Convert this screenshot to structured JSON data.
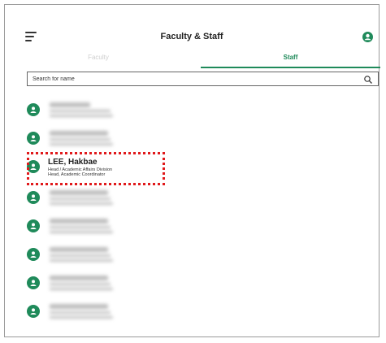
{
  "header": {
    "title": "Faculty & Staff"
  },
  "tabs": [
    {
      "label": "Faculty",
      "active": false
    },
    {
      "label": "Staff",
      "active": true
    }
  ],
  "search": {
    "placeholder": "Search for name",
    "value": ""
  },
  "highlighted_person": {
    "name": "LEE, Hakbae",
    "line1": "Head / Academic Affairs Division",
    "line2": "Head, Academic Coordinator"
  },
  "colors": {
    "accent": "#1f8a5a",
    "highlight_border": "#e0191b"
  },
  "icons": {
    "menu": "hamburger-menu-icon",
    "profile": "user-icon",
    "search": "search-icon",
    "avatar": "user-icon"
  }
}
